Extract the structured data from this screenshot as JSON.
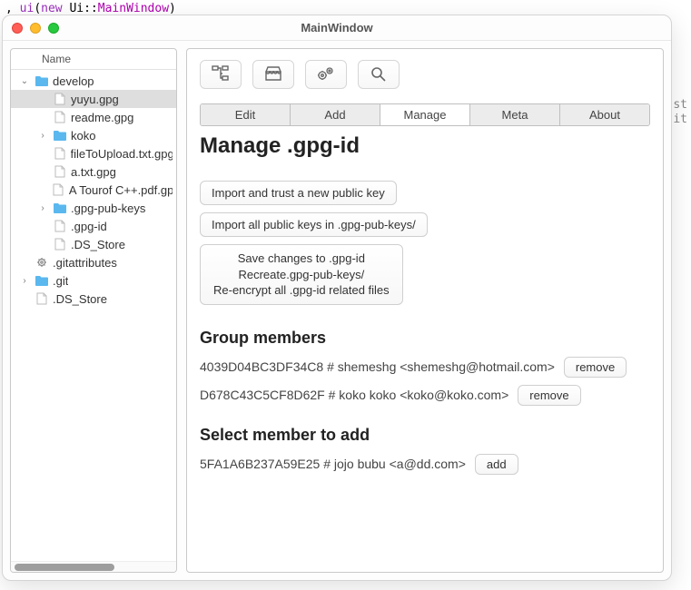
{
  "code_line": ", ui(new Ui::MainWindow)",
  "code_far": "st\nit",
  "window": {
    "title": "MainWindow"
  },
  "tree": {
    "header": "Name",
    "items": [
      {
        "depth": 0,
        "expand": "expanded",
        "icon": "folder",
        "label": "develop"
      },
      {
        "depth": 1,
        "expand": "none",
        "icon": "file",
        "label": "yuyu.gpg",
        "selected": true
      },
      {
        "depth": 1,
        "expand": "none",
        "icon": "file",
        "label": "readme.gpg"
      },
      {
        "depth": 1,
        "expand": "collapsed",
        "icon": "folder",
        "label": "koko"
      },
      {
        "depth": 1,
        "expand": "none",
        "icon": "file",
        "label": "fileToUpload.txt.gpg"
      },
      {
        "depth": 1,
        "expand": "none",
        "icon": "file",
        "label": "a.txt.gpg"
      },
      {
        "depth": 1,
        "expand": "none",
        "icon": "file",
        "label": "A Tourof C++.pdf.gpg"
      },
      {
        "depth": 1,
        "expand": "collapsed",
        "icon": "folder",
        "label": ".gpg-pub-keys"
      },
      {
        "depth": 1,
        "expand": "none",
        "icon": "file",
        "label": ".gpg-id"
      },
      {
        "depth": 1,
        "expand": "none",
        "icon": "file",
        "label": ".DS_Store"
      },
      {
        "depth": 0,
        "expand": "none",
        "icon": "gear",
        "label": ".gitattributes"
      },
      {
        "depth": 0,
        "expand": "collapsed",
        "icon": "folder",
        "label": ".git"
      },
      {
        "depth": 0,
        "expand": "none",
        "icon": "file",
        "label": ".DS_Store"
      }
    ]
  },
  "toolbar_icons": [
    "tree-icon",
    "storefront-icon",
    "gears-icon",
    "magnifier-icon"
  ],
  "tabs": {
    "items": [
      "Edit",
      "Add",
      "Manage",
      "Meta",
      "About"
    ],
    "active_index": 2
  },
  "manage": {
    "title": "Manage .gpg-id",
    "buttons": {
      "import_trust": "Import and trust a new public key",
      "import_all": "Import all public keys in .gpg-pub-keys/",
      "save_block": "Save changes to .gpg-id\nRecreate.gpg-pub-keys/\nRe-encrypt all .gpg-id related files"
    },
    "group_heading": "Group members",
    "members": [
      {
        "text": "4039D04BC3DF34C8 # shemeshg <shemeshg@hotmail.com>",
        "action": "remove"
      },
      {
        "text": "D678C43C5CF8D62F # koko koko <koko@koko.com>",
        "action": "remove"
      }
    ],
    "select_heading": "Select member to add",
    "candidates": [
      {
        "text": "5FA1A6B237A59E25 # jojo bubu <a@dd.com>",
        "action": "add"
      }
    ]
  }
}
